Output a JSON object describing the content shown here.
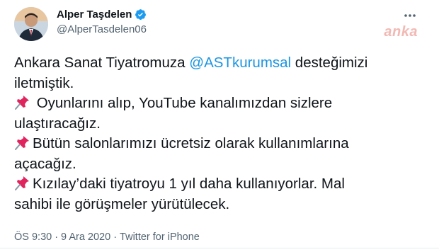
{
  "user": {
    "name": "Alper Taşdelen",
    "handle": "@AlperTasdelen06",
    "verified": true
  },
  "watermark": "anka",
  "icons": {
    "more": "more-options-icon",
    "verified": "verified-badge-icon",
    "pin": "pushpin-icon"
  },
  "tweet": {
    "line1_prefix": "Ankara Sanat Tiyatromuza ",
    "mention": "@ASTkurumsal",
    "line1_suffix": " desteğimizi",
    "line2": "iletmiştik.",
    "line3": " Oyunlarını alıp, YouTube kanalımızdan sizlere",
    "line4": "ulaştıracağız.",
    "line5": "Bütün salonlarımızı ücretsiz olarak kullanımlarına",
    "line6": "açacağız.",
    "line7": "Kızılay’daki tiyatroyu 1 yıl daha kullanıyorlar. Mal",
    "line8": "sahibi ile görüşmeler yürütülecek."
  },
  "meta": {
    "time": "ÖS 9:30",
    "sep1": "·",
    "date": "9 Ara 2020",
    "sep2": "·",
    "source": "Twitter for iPhone"
  },
  "colors": {
    "link": "#1b95e0",
    "secondary_text": "#536471",
    "verified": "#1d9bf0",
    "pin": "#e0245e"
  }
}
